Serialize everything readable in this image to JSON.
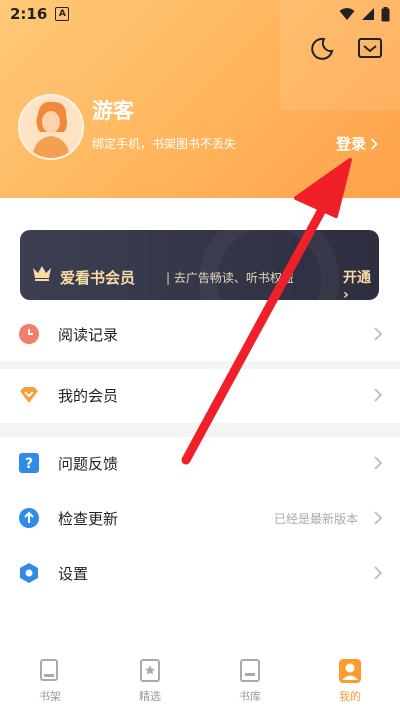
{
  "status_bar": {
    "time": "2:16",
    "app_icon_letter": "A"
  },
  "header": {
    "username": "游客",
    "subtitle": "绑定手机，书架图书不丢失",
    "login_label": "登录"
  },
  "vip_banner": {
    "title": "爱看书会员",
    "description": "去广告畅读、听书权益",
    "cta": "开通"
  },
  "menu": {
    "reading_history": "阅读记录",
    "my_membership": "我的会员",
    "feedback": "问题反馈",
    "check_update": "检查更新",
    "check_update_status": "已经是最新版本",
    "settings": "设置"
  },
  "bottom_nav": {
    "items": [
      {
        "label": "书架",
        "icon": "bookshelf-icon",
        "active": false
      },
      {
        "label": "精选",
        "icon": "featured-icon",
        "active": false
      },
      {
        "label": "书库",
        "icon": "library-icon",
        "active": false
      },
      {
        "label": "我的",
        "icon": "profile-icon",
        "active": true
      }
    ]
  },
  "colors": {
    "header_gradient_start": "#ffc978",
    "header_gradient_end": "#ffa24a",
    "vip_card_bg": "#2d2f40",
    "vip_gold": "#f7dca6",
    "active_tab": "#ff9a2e",
    "annotation_arrow": "#f0202a"
  }
}
